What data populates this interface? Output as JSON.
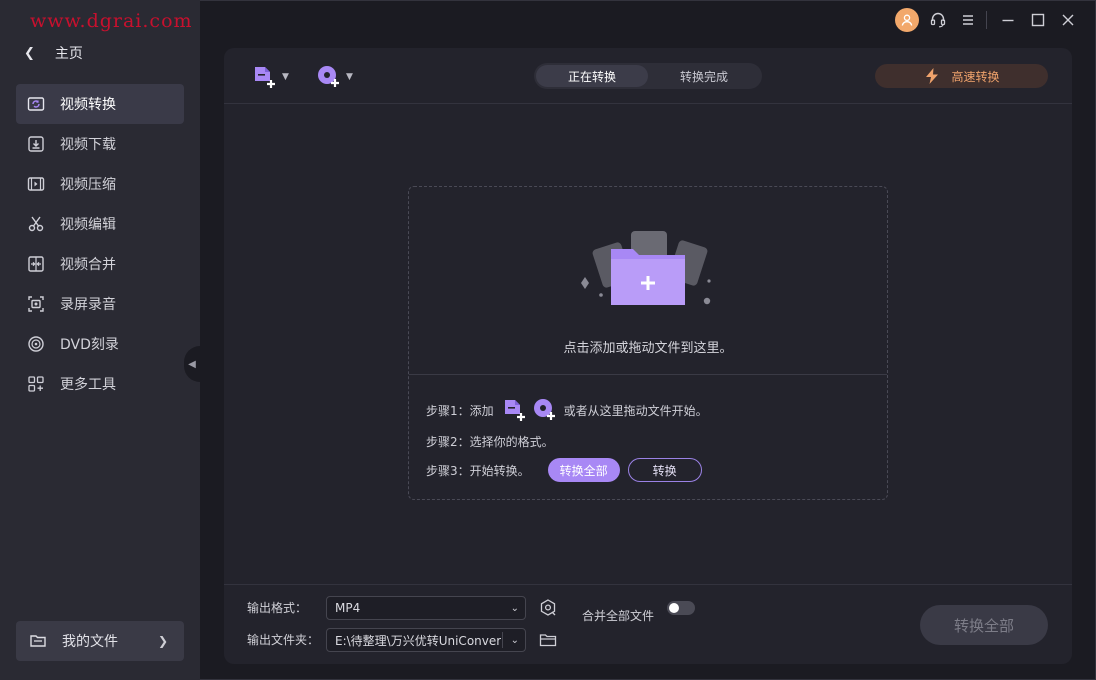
{
  "watermark": "www.dgrai.com",
  "sidebar": {
    "home_label": "主页",
    "items": [
      {
        "label": "视频转换",
        "icon": "video-convert-icon",
        "active": true
      },
      {
        "label": "视频下载",
        "icon": "download-icon",
        "active": false
      },
      {
        "label": "视频压缩",
        "icon": "compress-icon",
        "active": false
      },
      {
        "label": "视频编辑",
        "icon": "scissors-icon",
        "active": false
      },
      {
        "label": "视频合并",
        "icon": "merge-icon",
        "active": false
      },
      {
        "label": "录屏录音",
        "icon": "screen-record-icon",
        "active": false
      },
      {
        "label": "DVD刻录",
        "icon": "dvd-icon",
        "active": false
      },
      {
        "label": "更多工具",
        "icon": "grid-icon",
        "active": false
      }
    ],
    "my_files_label": "我的文件"
  },
  "header": {
    "tabs": [
      {
        "label": "正在转换",
        "active": true
      },
      {
        "label": "转换完成",
        "active": false
      }
    ],
    "fast_convert_label": "高速转换"
  },
  "dropzone": {
    "hint": "点击添加或拖动文件到这里。",
    "step1_prefix": "步骤1：添加",
    "step1_suffix": "或者从这里拖动文件开始。",
    "step2": "步骤2：选择你的格式。",
    "step3": "步骤3：开始转换。",
    "convert_all_label": "转换全部",
    "convert_label": "转换"
  },
  "footer": {
    "format_label": "输出格式：",
    "format_value": "MP4",
    "folder_label": "输出文件夹：",
    "folder_value": "E:\\待整理\\万兴优转UniConver",
    "merge_label": "合并全部文件",
    "merge_enabled": false,
    "convert_all_label": "转换全部"
  },
  "colors": {
    "accent": "#a888f5",
    "fast_convert": "#f0a36c",
    "avatar": "#f2a86b",
    "watermark": "#c8102e"
  }
}
